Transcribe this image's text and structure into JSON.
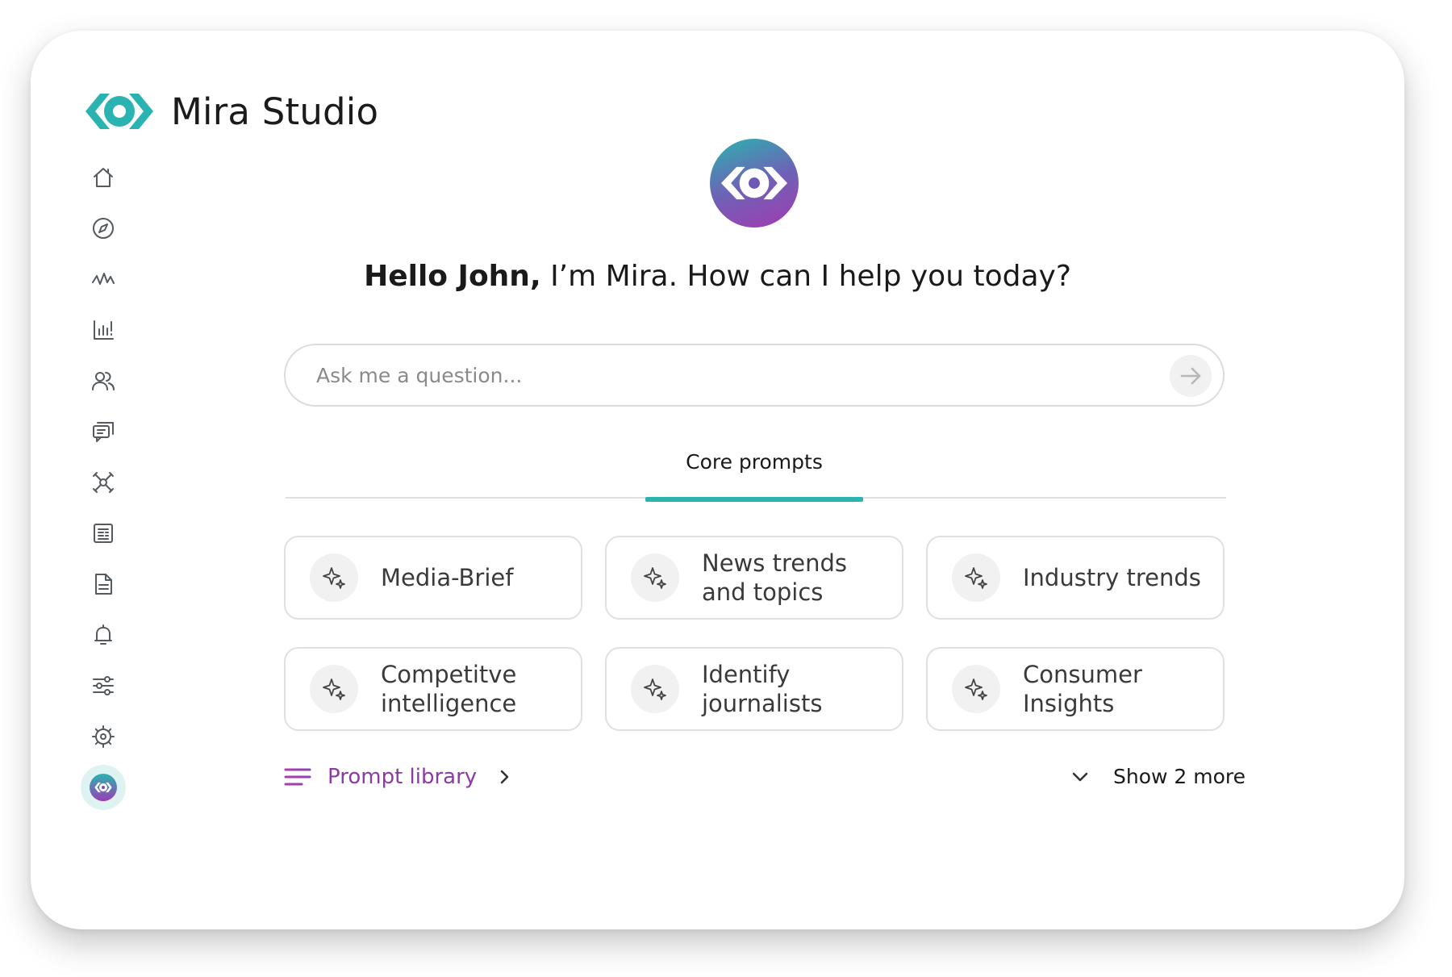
{
  "app": {
    "name": "Mira Studio"
  },
  "sidebar": {
    "items": [
      {
        "icon": "home-icon"
      },
      {
        "icon": "compass-icon"
      },
      {
        "icon": "activity-icon"
      },
      {
        "icon": "bar-chart-icon"
      },
      {
        "icon": "users-icon"
      },
      {
        "icon": "messages-icon"
      },
      {
        "icon": "network-icon"
      },
      {
        "icon": "newspaper-icon"
      },
      {
        "icon": "document-icon"
      },
      {
        "icon": "bell-icon"
      },
      {
        "icon": "sliders-icon"
      },
      {
        "icon": "settings-icon"
      },
      {
        "icon": "mira-avatar-icon"
      }
    ]
  },
  "greeting": {
    "name": "Hello John,",
    "message": " I’m Mira. How can I help you today?"
  },
  "search": {
    "placeholder": "Ask me a question...",
    "value": ""
  },
  "tabs": [
    {
      "label": "Core prompts",
      "active": true
    }
  ],
  "prompts": [
    {
      "label": "Media-Brief"
    },
    {
      "label": "News trends and topics"
    },
    {
      "label": "Industry trends"
    },
    {
      "label": "Competitve intelligence"
    },
    {
      "label": "Identify journalists"
    },
    {
      "label": "Consumer Insights"
    }
  ],
  "footer": {
    "library_label": "Prompt library",
    "show_more_label": "Show 2 more"
  },
  "colors": {
    "accent_teal": "#2bb3b1",
    "accent_purple": "#9b3db5",
    "border": "#e0e0e0"
  }
}
